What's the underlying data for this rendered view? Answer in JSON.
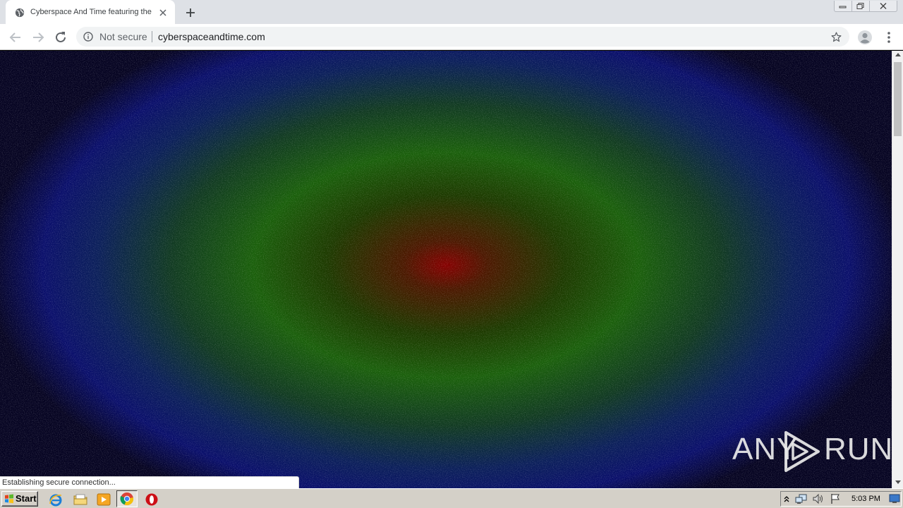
{
  "browser": {
    "tab_title": "Cyberspace And Time featuring the",
    "security_label": "Not secure",
    "url": "cyberspaceandtime.com",
    "status_text": "Establishing secure connection..."
  },
  "page": {
    "background_colors": {
      "center": "#860000",
      "mid": "#1a5f0b",
      "outer": "#0a0f6b",
      "edge": "#060422"
    }
  },
  "watermark": {
    "left_text": "ANY",
    "right_text": "RUN"
  },
  "taskbar": {
    "start_label": "Start",
    "clock": "5:03 PM",
    "pinned": [
      "ie-icon",
      "file-explorer-icon",
      "media-player-icon",
      "chrome-icon",
      "opera-icon"
    ]
  }
}
